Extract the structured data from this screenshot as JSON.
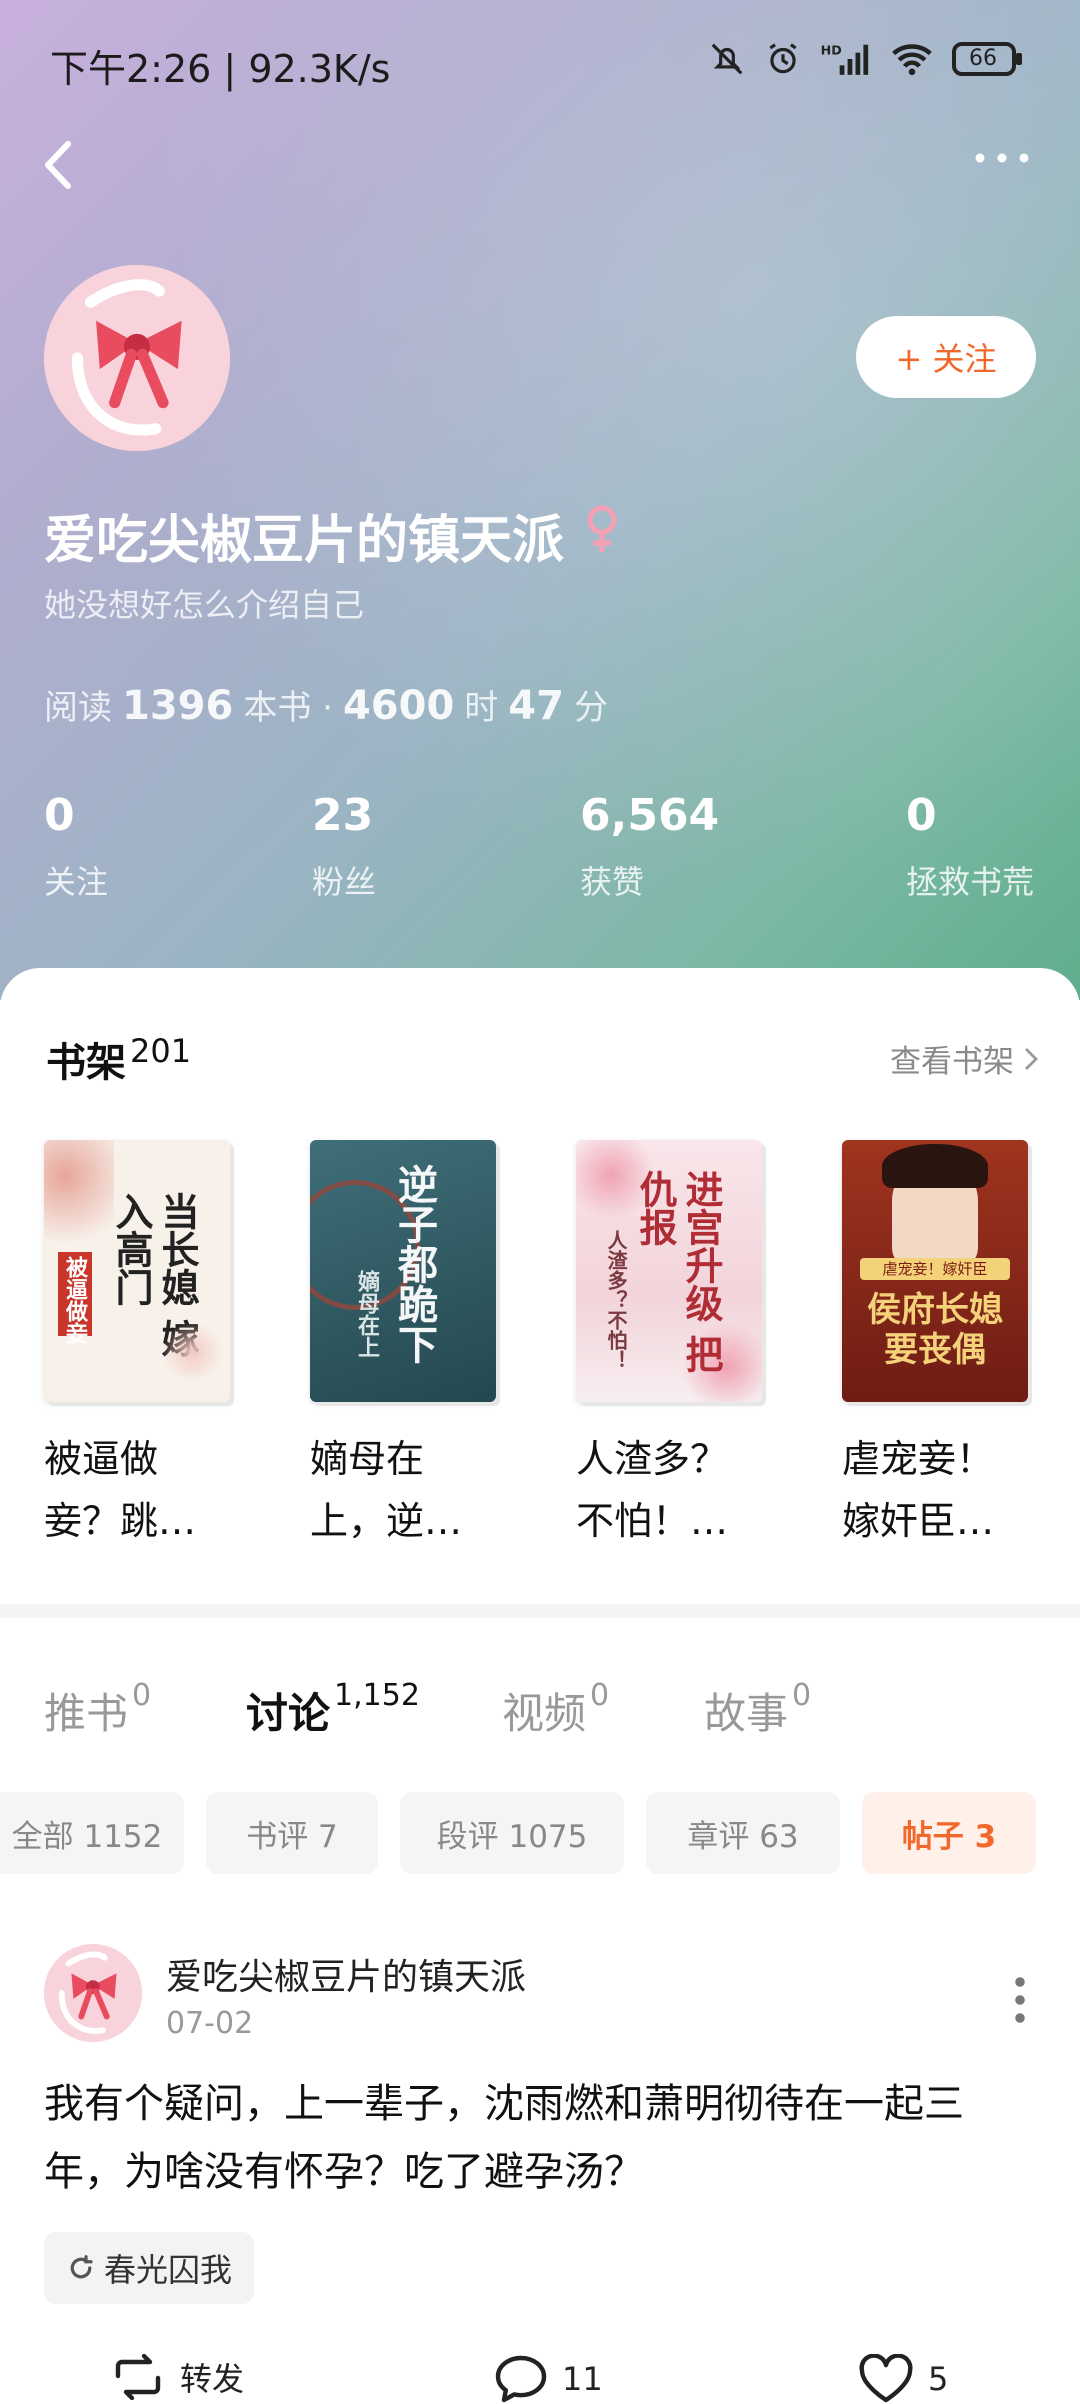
{
  "status_bar": {
    "time": "下午2:26",
    "speed": "92.3K/s",
    "battery": "66",
    "icons": [
      "mute-icon",
      "alarm-icon",
      "hd-signal-icon",
      "wifi-icon",
      "battery-icon"
    ]
  },
  "nav": {
    "back_icon": "chevron-left-icon",
    "more_icon": "ellipsis-icon"
  },
  "profile": {
    "name": "爱吃尖椒豆片的镇天派",
    "gender_icon": "female-icon",
    "bio": "她没想好怎么介绍自己",
    "follow_label": "+ 关注",
    "reading": {
      "prefix": "阅读",
      "books": "1396",
      "books_unit": "本书 ·",
      "hours": "4600",
      "hours_unit": "时",
      "minutes": "47",
      "minutes_unit": "分"
    },
    "stats": [
      {
        "value": "0",
        "label": "关注"
      },
      {
        "value": "23",
        "label": "粉丝"
      },
      {
        "value": "6,564",
        "label": "获赞"
      },
      {
        "value": "0",
        "label": "拯救书荒"
      }
    ]
  },
  "shelf": {
    "title": "书架",
    "count": "201",
    "link": "查看书架",
    "books": [
      {
        "title": "被逼做妾？跳…",
        "cover_text": "当长媳 嫁入高门",
        "cover_sub": "被逼做妾",
        "colors": {
          "bg": "#f7f1ea",
          "accent": "#c9342b"
        }
      },
      {
        "title": "嫡母在上，逆…",
        "cover_text": "逆子都跪下",
        "cover_sub": "嫡母在上",
        "colors": {
          "bg": "#2f5a66",
          "accent": "#e9eef0"
        }
      },
      {
        "title": "人渣多？不怕！…",
        "cover_text": "进宫升级 把仇报",
        "cover_sub": "人渣多？不怕！",
        "colors": {
          "bg": "#f6dde3",
          "accent": "#b12d36"
        }
      },
      {
        "title": "虐宠妾！嫁奸臣…",
        "cover_text": "侯府长媳 要丧偶",
        "cover_sub": "虐宠妾！嫁奸臣",
        "colors": {
          "bg": "#8a2a1f",
          "accent": "#f4d27a"
        }
      }
    ]
  },
  "content_tabs": [
    {
      "label": "推书",
      "count": "0",
      "active": false
    },
    {
      "label": "讨论",
      "count": "1,152",
      "active": true
    },
    {
      "label": "视频",
      "count": "0",
      "active": false
    },
    {
      "label": "故事",
      "count": "0",
      "active": false
    }
  ],
  "filter_chips": [
    {
      "label": "全部 1152",
      "active": false
    },
    {
      "label": "书评 7",
      "active": false
    },
    {
      "label": "段评 1075",
      "active": false
    },
    {
      "label": "章评 63",
      "active": false
    },
    {
      "label": "帖子 3",
      "active": true
    }
  ],
  "post": {
    "author": "爱吃尖椒豆片的镇天派",
    "date": "07-02",
    "body": "我有个疑问，上一辈子，沈雨燃和萧明彻待在一起三年，为啥没有怀孕？吃了避孕汤？",
    "topic": "春光囚我",
    "actions": {
      "repost": "转发",
      "comments": "11",
      "likes": "5"
    }
  },
  "theme": {
    "accent": "#f2672a",
    "hero_start": "#c9b0de",
    "hero_end": "#5fae8c"
  }
}
